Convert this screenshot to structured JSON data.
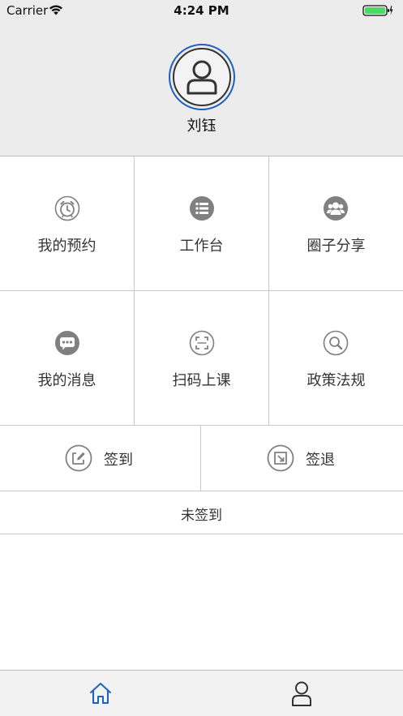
{
  "status_bar": {
    "carrier": "Carrier",
    "time": "4:24 PM"
  },
  "profile": {
    "name": "刘钰"
  },
  "grid": [
    {
      "label": "我的预约",
      "icon": "alarm-clock-icon"
    },
    {
      "label": "工作台",
      "icon": "list-icon"
    },
    {
      "label": "圈子分享",
      "icon": "group-icon"
    },
    {
      "label": "我的消息",
      "icon": "message-icon"
    },
    {
      "label": "扫码上课",
      "icon": "scan-icon"
    },
    {
      "label": "政策法规",
      "icon": "search-icon"
    }
  ],
  "sign": {
    "sign_in_label": "签到",
    "sign_out_label": "签退",
    "status_text": "未签到"
  },
  "tabbar": {
    "items": [
      "home-icon",
      "profile-icon"
    ],
    "active_color": "#1f5fbf"
  },
  "colors": {
    "accent": "#1f5fbf",
    "icon_gray": "#808080",
    "battery_green": "#4cd964"
  }
}
